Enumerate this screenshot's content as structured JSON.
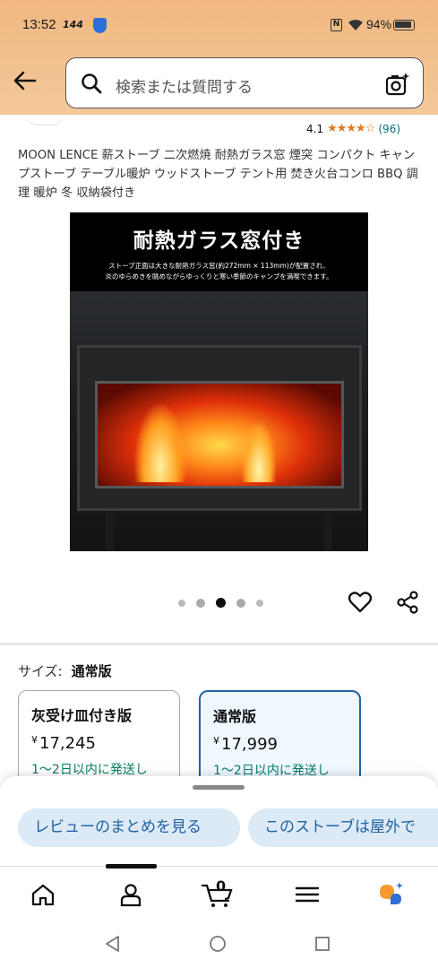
{
  "status_bar": {
    "time": "13:52",
    "refresh": "144",
    "battery": "94%"
  },
  "search": {
    "placeholder": "検索または質問する"
  },
  "product": {
    "rating": "4.1",
    "stars": "★★★★☆",
    "review_count": "(96)",
    "title": "MOON LENCE 薪ストーブ 二次燃焼 耐熱ガラス窓 煙突 コンパクト キャンプストーブ テーブル暖炉 ウッドストーブ テント用 焚き火台コンロ BBQ 調理 暖炉 冬 収納袋付き",
    "image": {
      "headline": "耐熱ガラス窓付き",
      "caption_line1": "ストーブ正面は大きな耐熱ガラス窓(約272mm × 113mm)が配置され、",
      "caption_line2": "炎のゆらめきを眺めながらゆっくりと寒い季節のキャンプを満喫できます。"
    },
    "carousel": {
      "count": 5,
      "active_index": 2
    }
  },
  "size": {
    "label": "サイズ:",
    "selected": "通常版",
    "options": [
      {
        "name": "灰受け皿付き版",
        "currency": "¥",
        "price": "17,245",
        "delivery": "1〜2日以内に発送し"
      },
      {
        "name": "通常版",
        "currency": "¥",
        "price": "17,999",
        "delivery": "1〜2日以内に発送し"
      }
    ]
  },
  "suggestions": [
    "レビューのまとめを見る",
    "このストーブは屋外で"
  ],
  "bottom_nav": {
    "cart_count": "0"
  },
  "colors": {
    "header_gradient_top": "#f0b781",
    "link": "#007185",
    "star": "#de7921",
    "selected_border": "#2162a1",
    "chip_bg": "#dceaf6",
    "delivery_green": "#067d62"
  }
}
